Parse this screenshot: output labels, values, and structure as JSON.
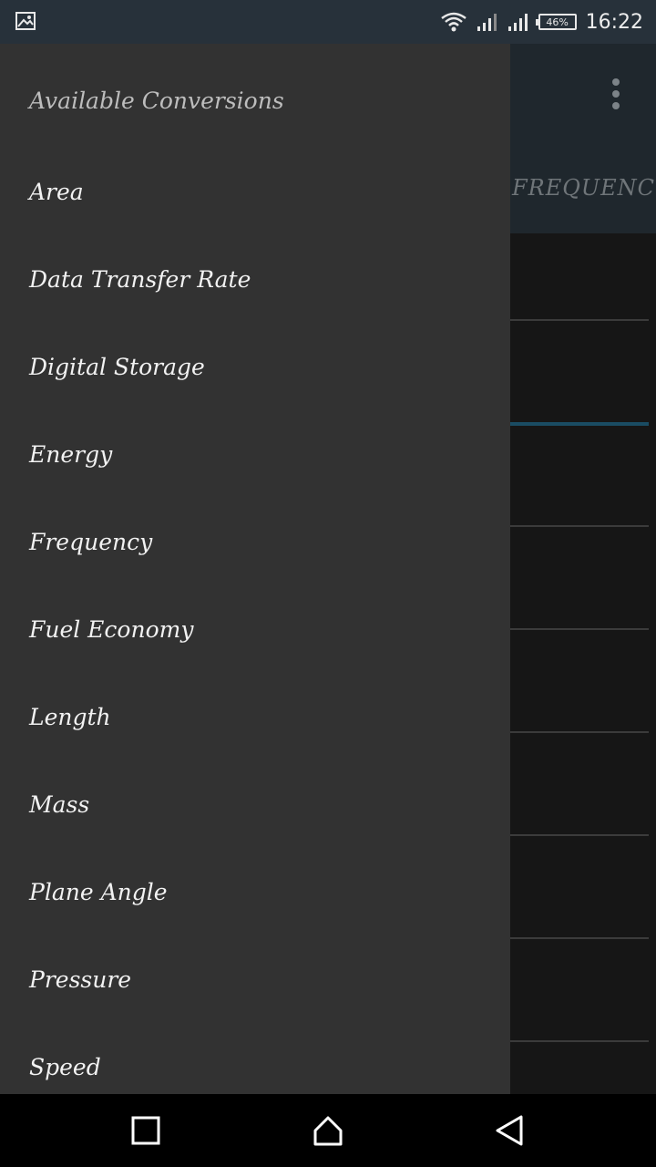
{
  "status_bar": {
    "battery_percent": "46%",
    "time": "16:22",
    "icons": [
      "image-notification-icon",
      "wifi-icon",
      "signal-1-icon",
      "signal-2-icon",
      "battery-icon"
    ]
  },
  "app": {
    "tab_label": "FREQUENCY",
    "overflow_icon": "more-vert-icon"
  },
  "drawer": {
    "header": "Available Conversions",
    "items": [
      {
        "label": "Area"
      },
      {
        "label": "Data Transfer Rate"
      },
      {
        "label": "Digital Storage"
      },
      {
        "label": "Energy"
      },
      {
        "label": "Frequency"
      },
      {
        "label": "Fuel Economy"
      },
      {
        "label": "Length"
      },
      {
        "label": "Mass"
      },
      {
        "label": "Plane Angle"
      },
      {
        "label": "Pressure"
      },
      {
        "label": "Speed"
      }
    ]
  },
  "nav_bar": {
    "icons": [
      "recents-icon",
      "home-icon",
      "back-icon"
    ]
  },
  "colors": {
    "drawer_bg": "#323232",
    "status_bar_bg": "#27313a",
    "accent": "#1a4c63",
    "text": "#f2f2f2"
  }
}
